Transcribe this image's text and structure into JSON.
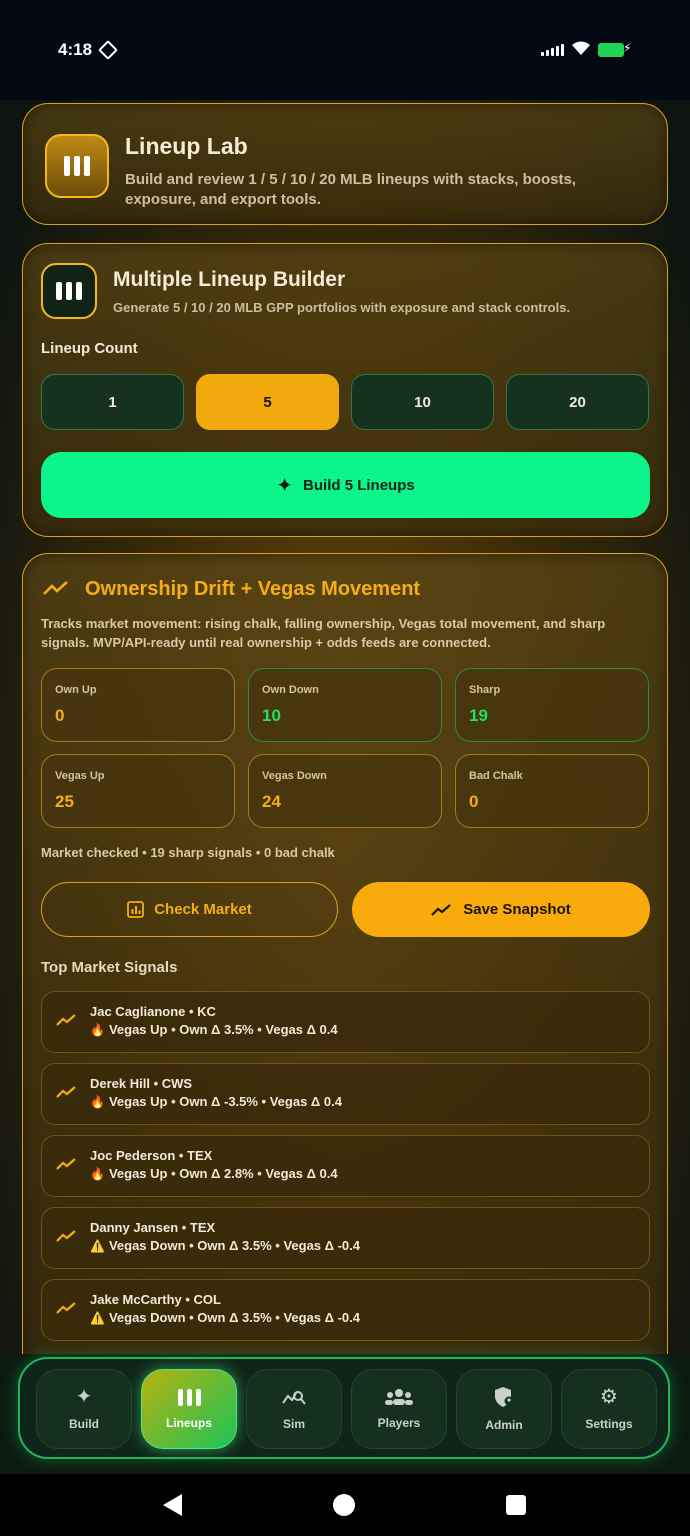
{
  "status_bar": {
    "time": "4:18"
  },
  "header_card": {
    "title": "Lineup Lab",
    "subtitle": "Build and review 1 / 5 / 10 / 20 MLB lineups with stacks, boosts, exposure, and export tools."
  },
  "builder": {
    "title": "Multiple Lineup Builder",
    "subtitle": "Generate 5 / 10 / 20 MLB GPP portfolios with exposure and stack controls.",
    "count_label": "Lineup Count",
    "counts": [
      "1",
      "5",
      "10",
      "20"
    ],
    "selected_count": "5",
    "build_button": "Build 5 Lineups"
  },
  "drift": {
    "title": "Ownership Drift + Vegas Movement",
    "description": "Tracks market movement: rising chalk, falling ownership, Vegas total movement, and sharp signals. MVP/API-ready until real ownership + odds feeds are connected.",
    "stats": [
      {
        "label": "Own Up",
        "value": "0"
      },
      {
        "label": "Own Down",
        "value": "10"
      },
      {
        "label": "Sharp",
        "value": "19"
      },
      {
        "label": "Vegas Up",
        "value": "25"
      },
      {
        "label": "Vegas Down",
        "value": "24"
      },
      {
        "label": "Bad Chalk",
        "value": "0"
      }
    ],
    "status": "Market checked • 19 sharp signals • 0 bad chalk",
    "check_button": "Check Market",
    "save_button": "Save Snapshot",
    "signals_title": "Top Market Signals",
    "signals": [
      {
        "name": "Jac Caglianone • KC",
        "emoji": "🔥",
        "meta": "Vegas Up • Own Δ 3.5% • Vegas Δ 0.4"
      },
      {
        "name": "Derek Hill • CWS",
        "emoji": "🔥",
        "meta": "Vegas Up • Own Δ -3.5% • Vegas Δ 0.4"
      },
      {
        "name": "Joc Pederson • TEX",
        "emoji": "🔥",
        "meta": "Vegas Up • Own Δ 2.8% • Vegas Δ 0.4"
      },
      {
        "name": "Danny Jansen • TEX",
        "emoji": "⚠️",
        "meta": "Vegas Down • Own Δ 3.5% • Vegas Δ -0.4"
      },
      {
        "name": "Jake McCarthy • COL",
        "emoji": "⚠️",
        "meta": "Vegas Down • Own Δ 3.5% • Vegas Δ -0.4"
      }
    ]
  },
  "nav": {
    "items": [
      {
        "label": "Build",
        "icon": "sparkles-icon"
      },
      {
        "label": "Lineups",
        "icon": "bars-icon"
      },
      {
        "label": "Sim",
        "icon": "chart-search-icon"
      },
      {
        "label": "Players",
        "icon": "people-icon"
      },
      {
        "label": "Admin",
        "icon": "shield-user-icon"
      },
      {
        "label": "Settings",
        "icon": "gear-icon"
      }
    ],
    "active": "Lineups"
  },
  "colors": {
    "accent_gold": "#f6ad15",
    "accent_green": "#0bf58a",
    "sharp_green": "#22e05d"
  }
}
